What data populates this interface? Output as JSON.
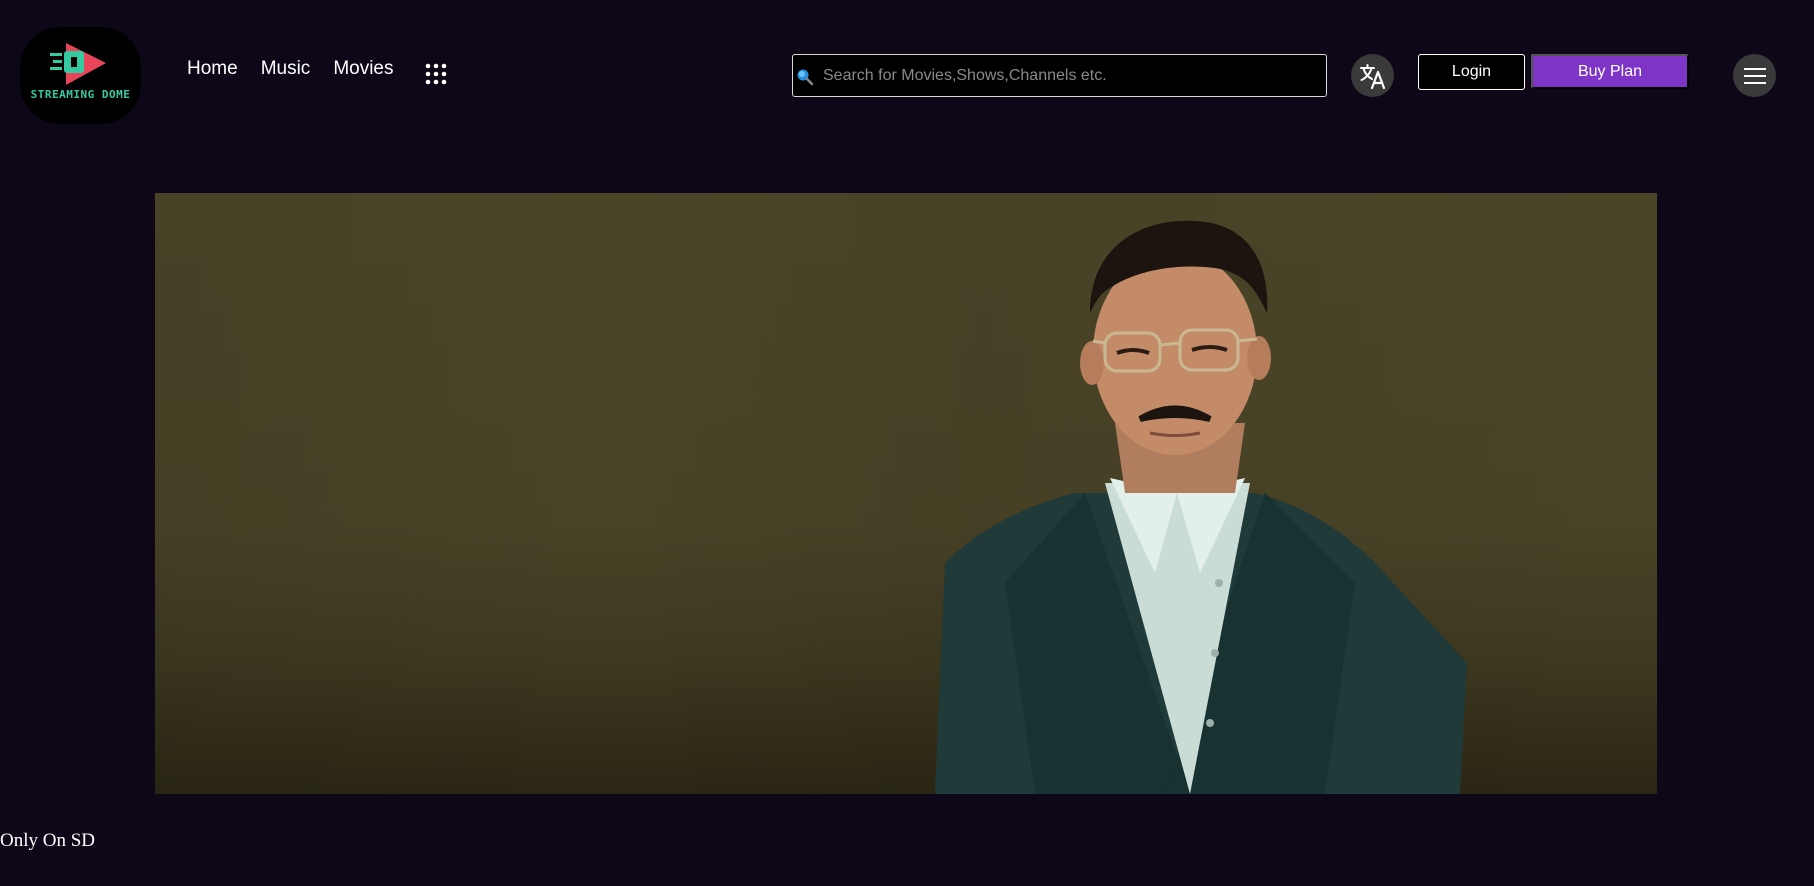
{
  "header": {
    "logo_text": "STREAMING DOME",
    "nav": [
      {
        "label": "Home"
      },
      {
        "label": "Music"
      },
      {
        "label": "Movies"
      }
    ],
    "apps_icon": "grid-dots-icon",
    "search": {
      "placeholder": "Search for Movies,Shows,Channels etc.",
      "value": "",
      "icon": "search-icon"
    },
    "translate_icon": "translate-icon",
    "login_label": "Login",
    "buy_plan_label": "Buy Plan",
    "menu_icon": "hamburger-menu-icon"
  },
  "banner": {
    "image": "man-in-suit-and-glasses-poster"
  },
  "section": {
    "title": "Only On SD"
  },
  "colors": {
    "background": "#0e0718",
    "accent": "#7e35c7",
    "logo_green": "#35c9a2",
    "logo_red": "#e8455a"
  }
}
